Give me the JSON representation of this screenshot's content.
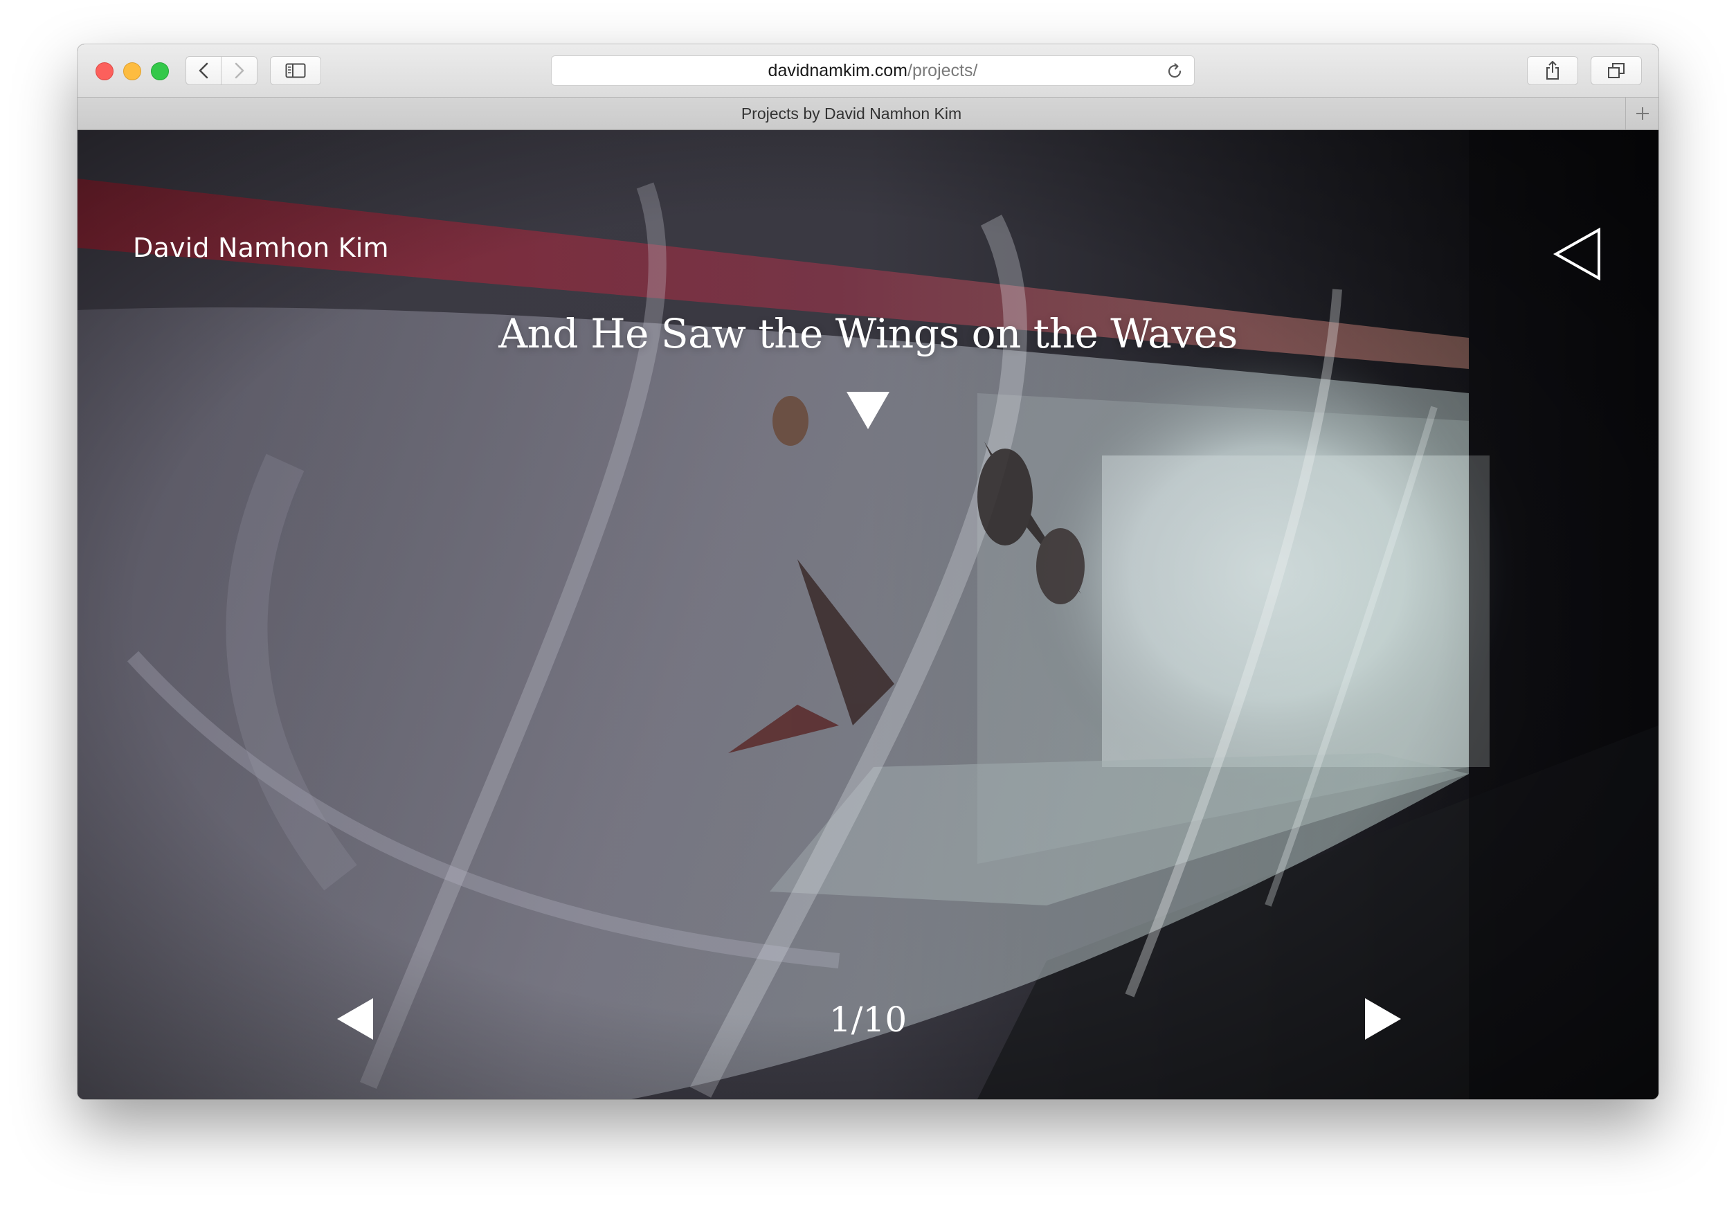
{
  "browser": {
    "url_domain": "davidnamkim.com",
    "url_path": "/projects/",
    "tab_title": "Projects by David Namhon Kim",
    "icons": {
      "back": "chevron-left-icon",
      "forward": "chevron-right-icon",
      "sidebar": "sidebar-icon",
      "reload": "reload-icon",
      "share": "share-icon",
      "tabs": "tabs-overview-icon",
      "new_tab": "plus-icon"
    },
    "traffic_light_colors": [
      "#fc605c",
      "#fdbc40",
      "#34c84a"
    ]
  },
  "page": {
    "site_title": "David Namhon Kim",
    "project_title": "And He Saw the Wings on the Waves",
    "slide_counter": "1/10",
    "icons": {
      "menu_toggle": "triangle-left-outline-icon",
      "scroll_down": "triangle-down-icon",
      "prev": "triangle-left-icon",
      "next": "triangle-right-icon"
    },
    "hero_image": "photo of sheer white fabric draped over a bed with butterflies, lit window on the right"
  }
}
